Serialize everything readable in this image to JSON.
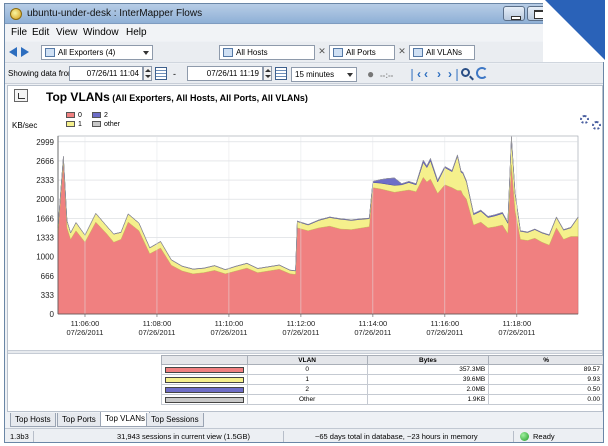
{
  "window": {
    "title": "ubuntu-under-desk : InterMapper Flows"
  },
  "menu": [
    "File",
    "Edit",
    "View",
    "Window",
    "Help"
  ],
  "filters": {
    "exporters": "All Exporters (4)",
    "hosts": "All Hosts",
    "ports": "All Ports",
    "vlans": "All VLANs"
  },
  "time": {
    "label": "Showing data from:",
    "from": "07/26/11 11:04",
    "to": "07/26/11 11:19",
    "interval": "15 minutes",
    "separator": "-",
    "playback": "--:--"
  },
  "chart_data": {
    "type": "area",
    "title": "Top VLANs",
    "subtitle": "(All Exporters, All Hosts, All Ports, All VLANs)",
    "ylabel": "KB/sec",
    "ylim": [
      0,
      3100
    ],
    "yticks": [
      "0",
      "333",
      "666",
      "1000",
      "1333",
      "1666",
      "2000",
      "2333",
      "2666",
      "2999"
    ],
    "xticks": [
      {
        "time": "11:06:00",
        "date": "07/26/2011"
      },
      {
        "time": "11:08:00",
        "date": "07/26/2011"
      },
      {
        "time": "11:10:00",
        "date": "07/26/2011"
      },
      {
        "time": "11:12:00",
        "date": "07/26/2011"
      },
      {
        "time": "11:14:00",
        "date": "07/26/2011"
      },
      {
        "time": "11:16:00",
        "date": "07/26/2011"
      },
      {
        "time": "11:18:00",
        "date": "07/26/2011"
      }
    ],
    "x_range_minutes": [
      11.07,
      11.19
    ],
    "legend": [
      {
        "label": "0",
        "color": "#f08080"
      },
      {
        "label": "1",
        "color": "#f5f08c"
      },
      {
        "label": "2",
        "color": "#6e6ec8"
      },
      {
        "label": "other",
        "color": "#c8c8c8"
      }
    ],
    "x": [
      5.25,
      5.4,
      5.5,
      5.6,
      5.75,
      6.0,
      6.3,
      6.6,
      6.8,
      7.0,
      7.2,
      7.5,
      7.8,
      8.1,
      8.4,
      8.7,
      9.0,
      9.3,
      9.6,
      9.9,
      10.2,
      10.5,
      10.8,
      11.1,
      11.4,
      11.7,
      11.85,
      11.9,
      12.2,
      12.5,
      12.8,
      13.1,
      13.4,
      13.7,
      13.9,
      14.0,
      14.2,
      14.4,
      14.6,
      14.8,
      15.0,
      15.2,
      15.4,
      15.5,
      15.6,
      15.8,
      16.0,
      16.2,
      16.35,
      16.45,
      16.5,
      16.6,
      16.8,
      17.0,
      17.2,
      17.4,
      17.6,
      17.75,
      17.85,
      17.95,
      18.1,
      18.3,
      18.5,
      18.7,
      18.9,
      19.1,
      19.3,
      19.5,
      19.7
    ],
    "series": [
      {
        "name": "0",
        "values": [
          1400,
          2650,
          1500,
          1300,
          1450,
          1250,
          1600,
          1400,
          1250,
          1300,
          1600,
          1450,
          1050,
          1150,
          850,
          750,
          700,
          720,
          760,
          700,
          750,
          800,
          720,
          750,
          780,
          700,
          690,
          1500,
          1450,
          1500,
          1530,
          1480,
          1470,
          1500,
          1520,
          2200,
          2180,
          2150,
          2120,
          2140,
          2160,
          2130,
          2380,
          2300,
          2350,
          2100,
          2250,
          2200,
          2150,
          2150,
          2080,
          2000,
          1550,
          1600,
          1500,
          1520,
          1550,
          1400,
          2600,
          1800,
          1300,
          1280,
          1320,
          1250,
          1200,
          1500,
          1300,
          1350,
          1350
        ]
      },
      {
        "name": "1",
        "values": [
          100,
          90,
          120,
          110,
          140,
          120,
          150,
          130,
          140,
          120,
          140,
          130,
          100,
          110,
          90,
          80,
          80,
          75,
          80,
          70,
          80,
          80,
          70,
          70,
          70,
          60,
          60,
          110,
          100,
          130,
          150,
          170,
          160,
          150,
          140,
          90,
          100,
          110,
          120,
          110,
          130,
          120,
          260,
          250,
          320,
          200,
          300,
          280,
          600,
          320,
          370,
          300,
          180,
          190,
          180,
          190,
          200,
          180,
          470,
          300,
          140,
          140,
          150,
          160,
          170,
          180,
          160,
          150,
          330
        ]
      },
      {
        "name": "2",
        "values": [
          5,
          5,
          5,
          5,
          5,
          5,
          5,
          5,
          5,
          5,
          5,
          5,
          5,
          5,
          5,
          5,
          5,
          5,
          5,
          5,
          5,
          5,
          5,
          5,
          5,
          5,
          5,
          10,
          10,
          10,
          10,
          10,
          10,
          10,
          10,
          20,
          60,
          100,
          130,
          20,
          20,
          20,
          40,
          30,
          40,
          30,
          20,
          20,
          20,
          20,
          20,
          20,
          20,
          20,
          20,
          20,
          20,
          20,
          20,
          20,
          10,
          10,
          10,
          10,
          10,
          10,
          10,
          10,
          10
        ]
      },
      {
        "name": "other",
        "values": [
          0,
          0,
          0,
          0,
          0,
          0,
          0,
          0,
          0,
          0,
          0,
          0,
          0,
          0,
          0,
          0,
          0,
          0,
          0,
          0,
          0,
          0,
          0,
          0,
          0,
          0,
          0,
          0,
          0,
          0,
          0,
          0,
          0,
          0,
          0,
          0,
          0,
          0,
          0,
          0,
          0,
          0,
          0,
          0,
          0,
          0,
          0,
          0,
          0,
          0,
          0,
          0,
          0,
          0,
          0,
          0,
          0,
          0,
          0,
          0,
          0,
          0,
          0,
          0,
          0,
          0,
          0,
          0,
          0
        ]
      }
    ]
  },
  "table": {
    "headers": [
      "VLAN",
      "Bytes",
      "%"
    ],
    "rows": [
      {
        "color": "#f08080",
        "vlan": "0",
        "bytes": "357.3MB",
        "pct": "89.57"
      },
      {
        "color": "#f5f08c",
        "vlan": "1",
        "bytes": "39.6MB",
        "pct": "9.93"
      },
      {
        "color": "#6e6ec8",
        "vlan": "2",
        "bytes": "2.0MB",
        "pct": "0.50"
      },
      {
        "color": "#c8c8c8",
        "vlan": "Other",
        "bytes": "1.9KB",
        "pct": "0.00"
      }
    ]
  },
  "tabs": [
    "Top Hosts",
    "Top Ports",
    "Top VLANs",
    "Top Sessions"
  ],
  "status": {
    "version": "1.3b3",
    "sessions": "31,943 sessions in current view (1.5GB)",
    "database": "~65 days total in database, ~23 hours in memory",
    "state": "Ready"
  }
}
